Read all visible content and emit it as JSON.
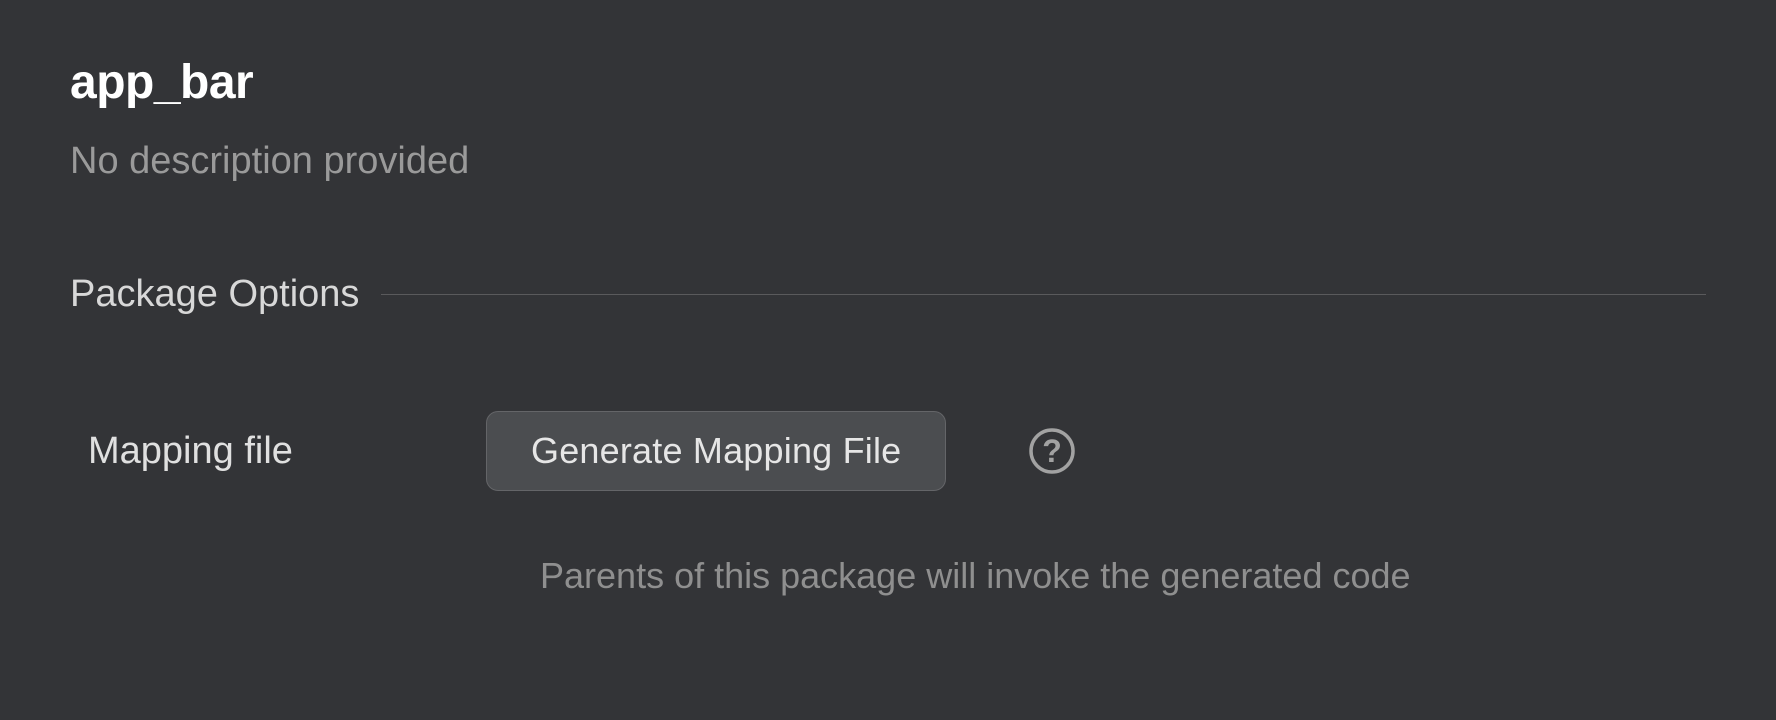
{
  "header": {
    "title": "app_bar",
    "description": "No description provided"
  },
  "section": {
    "title": "Package Options"
  },
  "options": {
    "mapping_file": {
      "label": "Mapping file",
      "button_label": "Generate Mapping File",
      "hint": "Parents of this package will invoke the generated code"
    }
  }
}
